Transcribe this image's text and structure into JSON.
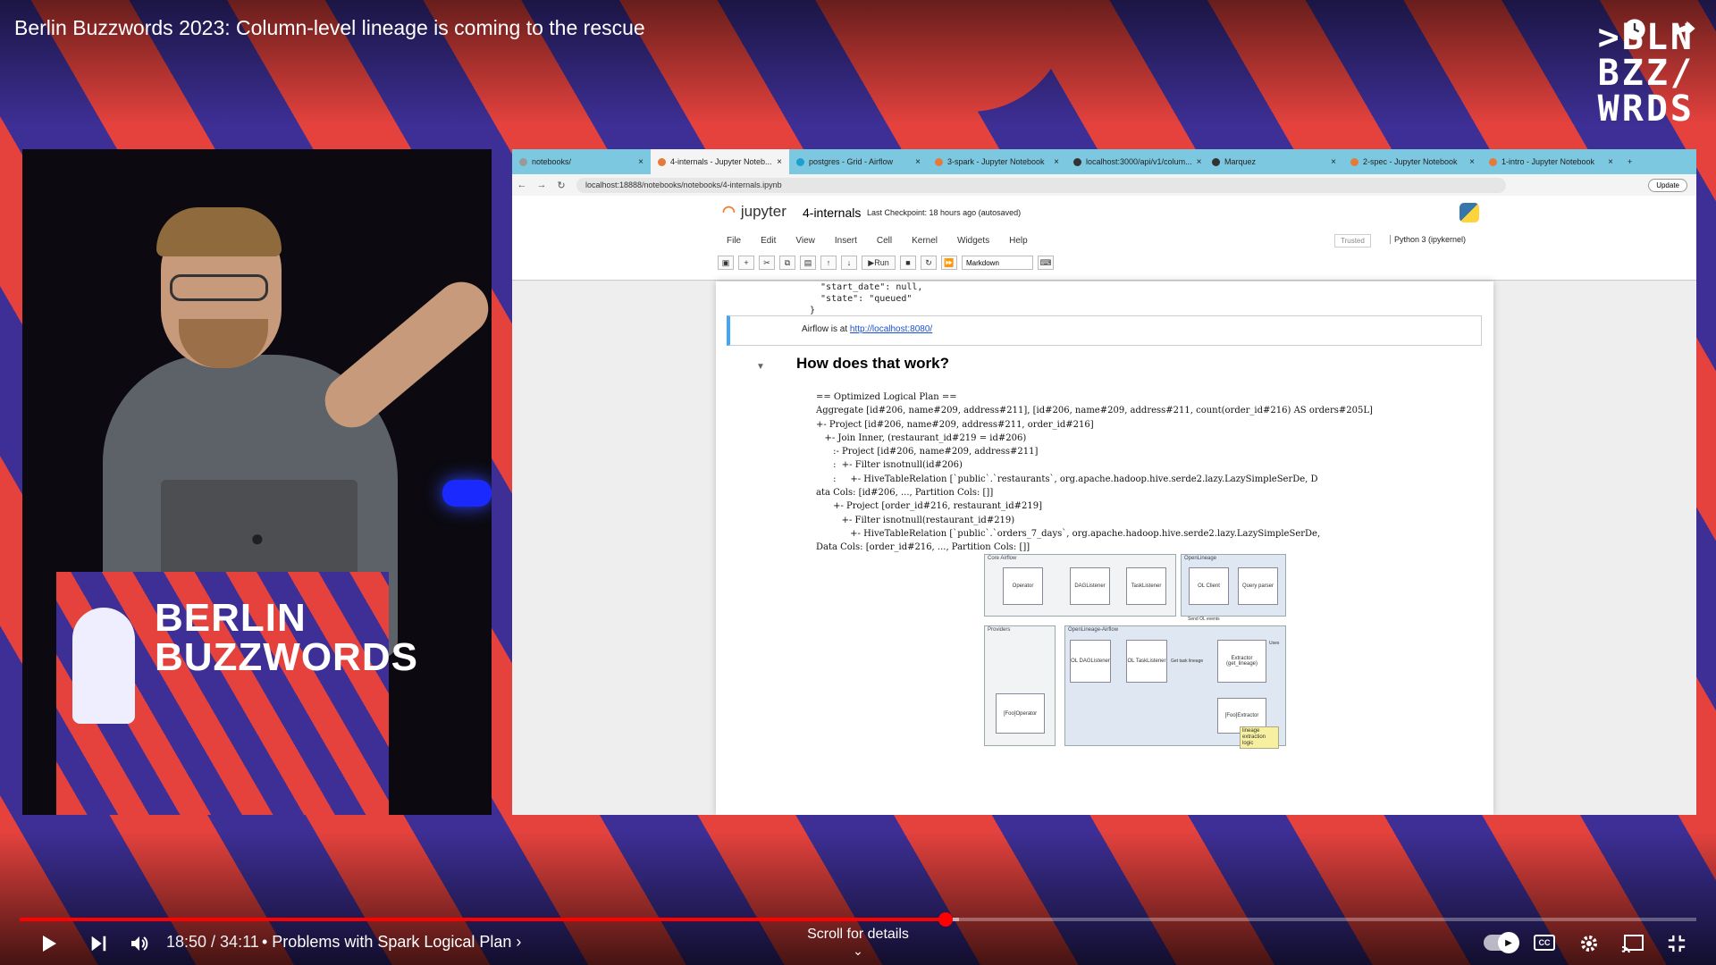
{
  "video": {
    "title": "Berlin Buzzwords 2023: Column-level lineage is coming to the rescue",
    "logo_lines": [
      ">BLN",
      "BZZ/",
      "WRDS"
    ],
    "top_icons": [
      "watch-later-icon",
      "share-icon"
    ]
  },
  "podium": {
    "line1": "BERLIN",
    "line2": "BUZZWORDS"
  },
  "browser": {
    "tabs": [
      {
        "label": "notebooks/"
      },
      {
        "label": "4-internals - Jupyter Noteb..."
      },
      {
        "label": "postgres - Grid - Airflow"
      },
      {
        "label": "3-spark - Jupyter Notebook"
      },
      {
        "label": "localhost:3000/api/v1/colum..."
      },
      {
        "label": "Marquez"
      },
      {
        "label": "2-spec - Jupyter Notebook"
      },
      {
        "label": "1-intro - Jupyter Notebook"
      }
    ],
    "url": "localhost:18888/notebooks/notebooks/4-internals.ipynb",
    "update_label": "Update"
  },
  "jupyter": {
    "brand": "jupyter",
    "notebook_name": "4-internals",
    "checkpoint": "Last Checkpoint: 18 hours ago  (autosaved)",
    "menu": [
      "File",
      "Edit",
      "View",
      "Insert",
      "Cell",
      "Kernel",
      "Widgets",
      "Help"
    ],
    "trusted": "Trusted",
    "kernel": "Python 3 (ipykernel)",
    "run_label": "Run",
    "cell_type": "Markdown"
  },
  "notebook": {
    "code_top": "  \"start_date\": null,\n  \"state\": \"queued\"\n}",
    "md_prefix": "Airflow is at ",
    "md_link": "http://localhost:8080/",
    "heading": "How does that work?",
    "plan": "== Optimized Logical Plan ==\nAggregate [id#206, name#209, address#211], [id#206, name#209, address#211, count(order_id#216) AS orders#205L]\n+- Project [id#206, name#209, address#211, order_id#216]\n   +- Join Inner, (restaurant_id#219 = id#206)\n      :- Project [id#206, name#209, address#211]\n      :  +- Filter isnotnull(id#206)\n      :     +- HiveTableRelation [`public`.`restaurants`, org.apache.hadoop.hive.serde2.lazy.LazySimpleSerDe, D\nata Cols: [id#206, ..., Partition Cols: []]\n      +- Project [order_id#216, restaurant_id#219]\n         +- Filter isnotnull(restaurant_id#219)\n            +- HiveTableRelation [`public`.`orders_7_days`, org.apache.hadoop.hive.serde2.lazy.LazySimpleSerDe,\nData Cols: [order_id#216, ..., Partition Cols: []]"
  },
  "diagram": {
    "groups": {
      "core": "Core Airflow",
      "openlineage": "OpenLineage",
      "providers": "Providers",
      "ol_airflow": "OpenLineage-Airflow"
    },
    "boxes": {
      "operator": "Operator",
      "dag_listener": "DAGListener",
      "task_listener": "TaskListener",
      "ol_client": "OL Client",
      "query_parser": "Query parser",
      "ol_dag_listener": "OL DAGListener",
      "ol_task_listener": "OL TaskListener",
      "extractor": "Extractor (get_lineage)",
      "foo_operator": "[Foo]Operator",
      "foo_extractor": "[Foo]Extractor"
    },
    "labels": {
      "send": "Send OL events",
      "get_lineage": "Get task lineage",
      "uses": "Uses"
    },
    "note": "lineage extraction logic"
  },
  "player": {
    "time": "18:50 / 34:11",
    "chapter": "• Problems with Spark Logical Plan ›",
    "scroll_hint": "Scroll for details",
    "progress_fraction": 0.552,
    "buffered_fraction": 0.56,
    "accent": "#ff0000"
  },
  "colors": {
    "stripe_red": "#e5423e",
    "stripe_blue": "#3d2f95"
  }
}
